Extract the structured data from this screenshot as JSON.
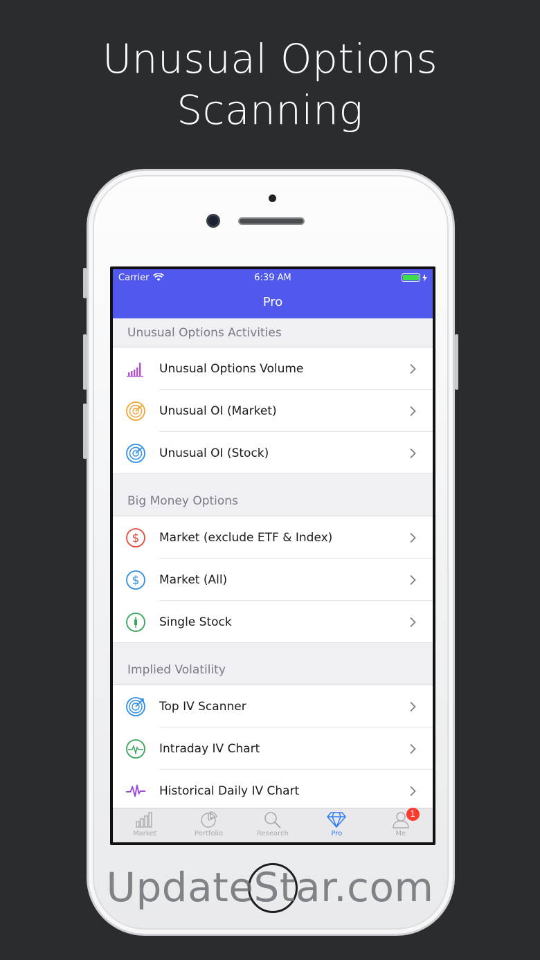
{
  "headline": {
    "line1": "Unusual Options",
    "line2": "Scanning"
  },
  "status_bar": {
    "carrier": "Carrier",
    "time": "6:39 AM"
  },
  "nav": {
    "title": "Pro"
  },
  "sections": [
    {
      "header": "Unusual Options Activities",
      "items": [
        {
          "label": "Unusual Options Volume",
          "icon": "bar-chart-icon",
          "color": "#b54fd0"
        },
        {
          "label": "Unusual OI (Market)",
          "icon": "radar-icon",
          "color": "#f3a435"
        },
        {
          "label": "Unusual OI (Stock)",
          "icon": "radar-icon",
          "color": "#2f8ee8"
        }
      ]
    },
    {
      "header": "Big Money Options",
      "items": [
        {
          "label": "Market (exclude ETF & Index)",
          "icon": "dollar-icon",
          "color": "#e2483d"
        },
        {
          "label": "Market (All)",
          "icon": "dollar-icon",
          "color": "#2f8ee8"
        },
        {
          "label": "Single Stock",
          "icon": "candlestick-icon",
          "color": "#3aa55b"
        }
      ]
    },
    {
      "header": "Implied Volatility",
      "items": [
        {
          "label": "Top IV Scanner",
          "icon": "target-icon",
          "color": "#2f8ee8"
        },
        {
          "label": "Intraday IV Chart",
          "icon": "pulse-clock-icon",
          "color": "#3aa55b"
        },
        {
          "label": "Historical Daily IV Chart",
          "icon": "heartbeat-icon",
          "color": "#9a47d8"
        }
      ]
    }
  ],
  "tabbar": {
    "tabs": [
      {
        "label": "Market",
        "icon": "bar-chart-icon"
      },
      {
        "label": "Portfolio",
        "icon": "pie-chart-icon"
      },
      {
        "label": "Research",
        "icon": "search-icon"
      },
      {
        "label": "Pro",
        "icon": "diamond-icon"
      },
      {
        "label": "Me",
        "icon": "person-icon"
      }
    ],
    "active": "Pro",
    "me_badge": "1"
  },
  "colors": {
    "nav_bg": "#5058ee",
    "active_tab": "#2f7df6",
    "background": "#2a2c2e"
  },
  "watermark": "UpdateStar.com"
}
